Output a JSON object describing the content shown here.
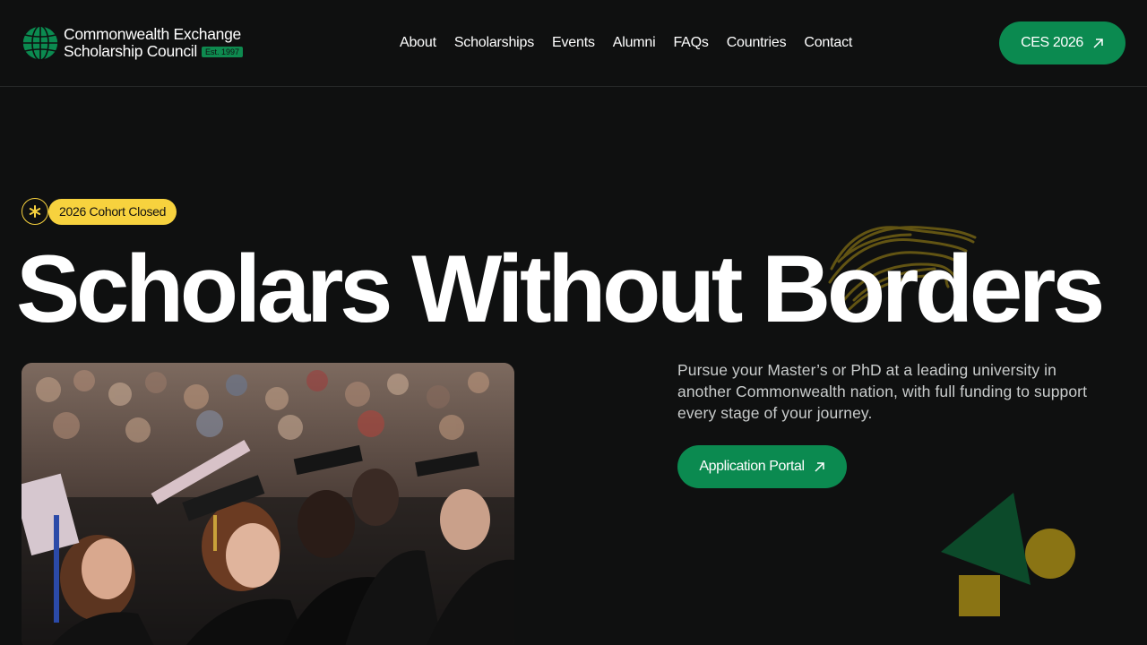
{
  "header": {
    "logo_line1": "Commonwealth Exchange",
    "logo_line2": "Scholarship Council",
    "est_badge": "Est. 1997",
    "nav": [
      "About",
      "Scholarships",
      "Events",
      "Alumni",
      "FAQs",
      "Countries",
      "Contact"
    ],
    "cta_label": "CES 2026"
  },
  "hero": {
    "status_badge": "2026 Cohort Closed",
    "title": "Scholars Without Borders",
    "description": "Pursue your Master’s or PhD at a leading university in another Commonwealth nation, with full funding to support every stage of your journey.",
    "portal_button": "Application Portal"
  },
  "colors": {
    "background": "#0f1010",
    "accent_green": "#0b8a50",
    "accent_yellow": "#f7d23e",
    "shape_dark_green": "#0c4a2a",
    "shape_olive": "#8a7414"
  },
  "icons": {
    "logo": "globe-icon",
    "cta_arrow": "arrow-up-right-icon",
    "status": "asterisk-icon"
  }
}
